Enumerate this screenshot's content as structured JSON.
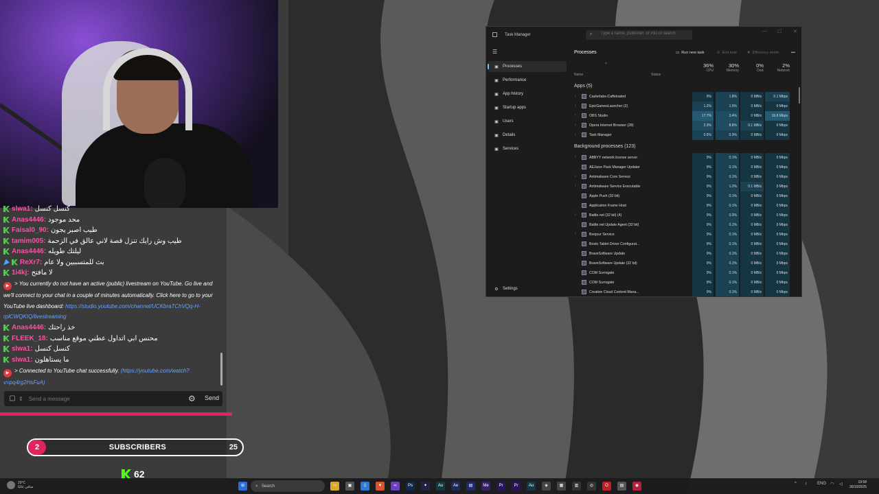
{
  "webcam": {},
  "chat": {
    "messages": [
      {
        "user": "slwa1:",
        "text": "كنسل كنسل",
        "color": "#ff4fa0",
        "badge": "kick"
      },
      {
        "user": "Anas4446:",
        "text": "محد موجود",
        "color": "#ff4fa0",
        "badge": "kick"
      },
      {
        "user": "Faisal0_90:",
        "text": "طيب اصبر يجون",
        "color": "#ff4fa0",
        "badge": "kick"
      },
      {
        "user": "tamim005:",
        "text": "طيب وش رايك تنزل قصة لاني عالق في الزحمة",
        "color": "#ff4fa0",
        "badge": "kick"
      },
      {
        "user": "Anas4446:",
        "text": "ليلتك طويله",
        "color": "#ff4fa0",
        "badge": "kick"
      },
      {
        "user": "ReXr7:",
        "text": "بث للمتسببين ولا عام",
        "color": "#ff4fa0",
        "badge": "mod"
      },
      {
        "user": "1i4kj:",
        "text": "لا مافتح",
        "color": "#ff4fa0",
        "badge": "kick"
      }
    ],
    "system1": {
      "text": "> You currently do not have an active (public) livestream on YouTube. Go live and we'll connect to your chat in a couple of minutes automatically. Click here to go to your YouTube live dashboard:",
      "link": "https://studio.youtube.com/channel/UCKbraTChVQq-H-rplCWQKIQ/livestreaming"
    },
    "messages2": [
      {
        "user": "Anas4446:",
        "text": "خذ راحتك",
        "color": "#ff4fa0",
        "badge": "kick"
      },
      {
        "user": "FLEEK_18:",
        "text": "محنس ابي اتداول عطني موقع مناسب",
        "color": "#ff4fa0",
        "badge": "kick"
      },
      {
        "user": "slwa1:",
        "text": "كنسل كنسل",
        "color": "#ff4fa0",
        "badge": "kick"
      },
      {
        "user": "slwa1:",
        "text": "ما يستاهلون",
        "color": "#ff4fa0",
        "badge": "kick"
      }
    ],
    "system2": {
      "text": "> Connected to YouTube chat successfully.",
      "link": "(https://youtube.com/watch?v=pq4rg2HsFuA)"
    },
    "input_placeholder": "Send a message",
    "send_label": "Send"
  },
  "subscribers": {
    "current": "2",
    "label": "SUBSCRIBERS",
    "goal": "25"
  },
  "kick_viewers": "62",
  "task_manager": {
    "title": "Task Manager",
    "search_placeholder": "Type a name, publisher, or PID to search",
    "nav": [
      {
        "label": "Processes",
        "icon": "processes-icon"
      },
      {
        "label": "Performance",
        "icon": "performance-icon"
      },
      {
        "label": "App history",
        "icon": "app-history-icon"
      },
      {
        "label": "Startup apps",
        "icon": "startup-icon"
      },
      {
        "label": "Users",
        "icon": "users-icon"
      },
      {
        "label": "Details",
        "icon": "details-icon"
      },
      {
        "label": "Services",
        "icon": "services-icon"
      }
    ],
    "settings_label": "Settings",
    "page_title": "Processes",
    "toolbar": {
      "run": "Run new task",
      "end": "End task",
      "efficiency": "Efficiency mode"
    },
    "columns": {
      "name": "Name",
      "status": "Status",
      "cpu": {
        "pct": "36%",
        "label": "CPU"
      },
      "memory": {
        "pct": "30%",
        "label": "Memory"
      },
      "disk": {
        "pct": "0%",
        "label": "Disk"
      },
      "network": {
        "pct": "2%",
        "label": "Network"
      }
    },
    "apps_group": "Apps (5)",
    "apps": [
      {
        "name": "Casterlabs-Caffeinated",
        "cpu": "0%",
        "mem": "1.8%",
        "disk": "0 MB/s",
        "net": "0.1 Mbps"
      },
      {
        "name": "EpicGamesLauncher (2)",
        "cpu": "1.2%",
        "mem": "1.0%",
        "disk": "0 MB/s",
        "net": "0 Mbps"
      },
      {
        "name": "OBS Studio",
        "cpu": "17.7%",
        "mem": "3.4%",
        "disk": "0 MB/s",
        "net": "19.8 Mbps"
      },
      {
        "name": "Opera Internet Browser (28)",
        "cpu": "2.3%",
        "mem": "8.8%",
        "disk": "0.1 MB/s",
        "net": "0 Mbps"
      },
      {
        "name": "Task Manager",
        "cpu": "0.5%",
        "mem": "0.3%",
        "disk": "0 MB/s",
        "net": "0 Mbps"
      }
    ],
    "bg_group": "Background processes (123)",
    "background": [
      {
        "name": "ABBYY network license server",
        "cpu": "0%",
        "mem": "0.1%",
        "disk": "0 MB/s",
        "net": "0 Mbps"
      },
      {
        "name": "AEJuice Pack Manager Updater",
        "cpu": "0%",
        "mem": "0.1%",
        "disk": "0 MB/s",
        "net": "0 Mbps"
      },
      {
        "name": "Antimalware Core Service",
        "cpu": "0%",
        "mem": "0.1%",
        "disk": "0 MB/s",
        "net": "0 Mbps"
      },
      {
        "name": "Antimalware Service Executable",
        "cpu": "0%",
        "mem": "1.2%",
        "disk": "0.1 MB/s",
        "net": "0 Mbps"
      },
      {
        "name": "Apple Push (32 bit)",
        "cpu": "0%",
        "mem": "0.1%",
        "disk": "0 MB/s",
        "net": "0 Mbps"
      },
      {
        "name": "Application Frame Host",
        "cpu": "0%",
        "mem": "0.1%",
        "disk": "0 MB/s",
        "net": "0 Mbps"
      },
      {
        "name": "Battle.net (32 bit) (4)",
        "cpu": "0%",
        "mem": "0.3%",
        "disk": "0 MB/s",
        "net": "0 Mbps"
      },
      {
        "name": "Battle.net Update Agent (32 bit)",
        "cpu": "0%",
        "mem": "0.1%",
        "disk": "0 MB/s",
        "net": "0 Mbps"
      },
      {
        "name": "Bonjour Service",
        "cpu": "0%",
        "mem": "0.1%",
        "disk": "0 MB/s",
        "net": "0 Mbps"
      },
      {
        "name": "Bosto Tablet Driver Configurat...",
        "cpu": "0%",
        "mem": "0.1%",
        "disk": "0 MB/s",
        "net": "0 Mbps"
      },
      {
        "name": "BraveSoftware Update",
        "cpu": "0%",
        "mem": "0.1%",
        "disk": "0 MB/s",
        "net": "0 Mbps"
      },
      {
        "name": "BraveSoftware Update (32 bit)",
        "cpu": "0%",
        "mem": "0.1%",
        "disk": "0 MB/s",
        "net": "0 Mbps"
      },
      {
        "name": "COM Surrogate",
        "cpu": "0%",
        "mem": "0.1%",
        "disk": "0 MB/s",
        "net": "0 Mbps"
      },
      {
        "name": "COM Surrogate",
        "cpu": "0%",
        "mem": "0.1%",
        "disk": "0 MB/s",
        "net": "0 Mbps"
      },
      {
        "name": "Creative Cloud Content Mana...",
        "cpu": "0%",
        "mem": "0.1%",
        "disk": "0 MB/s",
        "net": "0 Mbps"
      }
    ]
  },
  "taskbar": {
    "weather_temp": "29°C",
    "weather_desc": "صافي غالبًا",
    "search_label": "Search",
    "lang": "ENG",
    "time": "19:58",
    "date": "30/10/2025"
  }
}
